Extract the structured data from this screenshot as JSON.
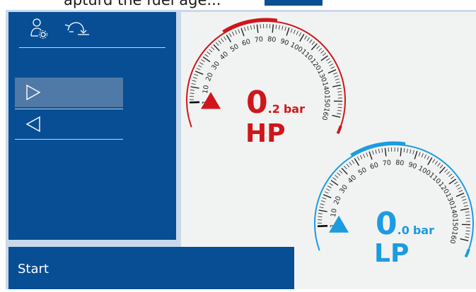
{
  "header": {
    "partial_text": "apturd the fuel age...",
    "accent": "#0a4f92"
  },
  "sidebar": {
    "icons": [
      "user-settings-icon",
      "undo-icon"
    ],
    "buttons": [
      {
        "icon": "play-forward-icon",
        "selected": true
      },
      {
        "icon": "play-back-icon",
        "selected": false
      }
    ]
  },
  "footer": {
    "start_label": "Start"
  },
  "gauges": [
    {
      "id": "hp",
      "label": "HP",
      "value_int": "0",
      "value_dec": ".2",
      "unit": "bar",
      "value": 0.2,
      "color": "#d0161b",
      "ticks": [
        "1",
        "10",
        "20",
        "30",
        "40",
        "50",
        "60",
        "70",
        "80",
        "90",
        "100",
        "110",
        "120",
        "130",
        "140",
        "150",
        "160"
      ]
    },
    {
      "id": "lp",
      "label": "LP",
      "value_int": "0",
      "value_dec": ".0",
      "unit": "bar",
      "value": 0.0,
      "color": "#1c9be0",
      "ticks": [
        "1",
        "10",
        "20",
        "30",
        "40",
        "50",
        "60",
        "70",
        "80",
        "90",
        "100",
        "110",
        "120",
        "130",
        "140",
        "150",
        "160"
      ]
    }
  ],
  "colors": {
    "panel": "#074e94",
    "panel_selected": "#4f79a6",
    "gauge_bg": "#f1f3f2"
  }
}
